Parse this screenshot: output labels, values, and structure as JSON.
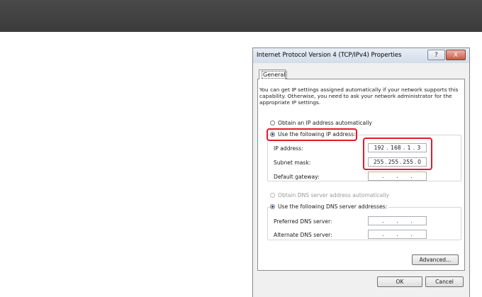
{
  "dialog": {
    "title": "Internet Protocol Version 4 (TCP/IPv4) Properties",
    "help_glyph": "?",
    "close_glyph": "X",
    "tab_general": "General",
    "description": "You can get IP settings assigned automatically if your network supports this capability. Otherwise, you need to ask your network administrator for the appropriate IP settings.",
    "radio_auto_ip": "Obtain an IP address automatically",
    "radio_manual_ip": "Use the following IP address:",
    "ip_label": "IP address:",
    "ip_octets": [
      "192",
      "168",
      "1",
      "3"
    ],
    "subnet_label": "Subnet mask:",
    "subnet_octets": [
      "255",
      "255",
      "255",
      "0"
    ],
    "gateway_label": "Default gateway:",
    "gateway_octets": [
      "",
      "",
      "",
      ""
    ],
    "radio_auto_dns": "Obtain DNS server address automatically",
    "radio_manual_dns": "Use the following DNS server addresses:",
    "preferred_dns_label": "Preferred DNS server:",
    "alternate_dns_label": "Alternate DNS server:",
    "advanced_button": "Advanced...",
    "ok_button": "OK",
    "cancel_button": "Cancel"
  },
  "colors": {
    "highlight": "#e01b2b",
    "topbar": "#404040"
  }
}
